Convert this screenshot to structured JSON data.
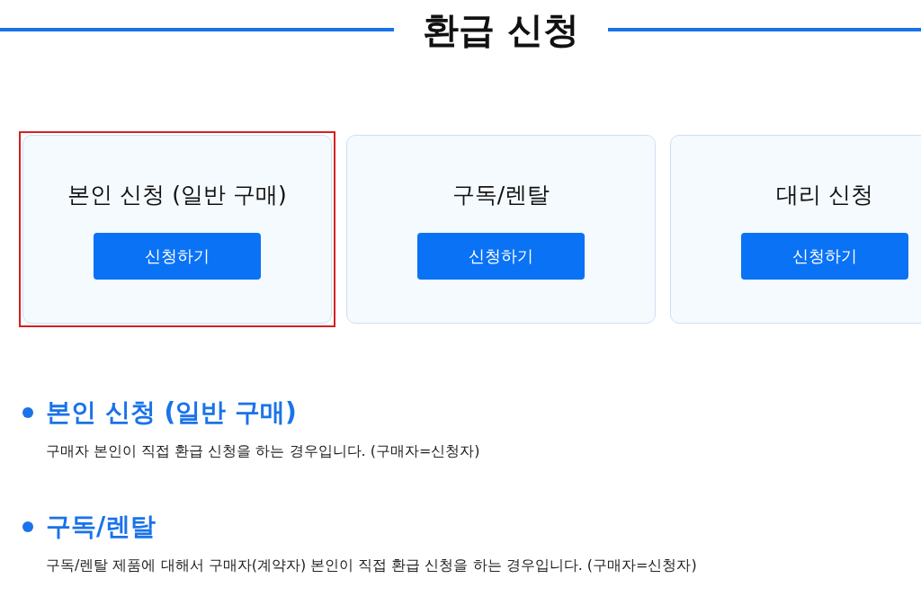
{
  "title": "환급 신청",
  "cards": [
    {
      "title": "본인 신청 (일반 구매)",
      "button": "신청하기",
      "selected": true
    },
    {
      "title": "구독/렌탈",
      "button": "신청하기",
      "selected": false
    },
    {
      "title": "대리 신청",
      "button": "신청하기",
      "selected": false
    }
  ],
  "sections": [
    {
      "heading": "본인 신청 (일반 구매)",
      "description": "구매자 본인이 직접 환급 신청을 하는 경우입니다. (구매자=신청자)"
    },
    {
      "heading": "구독/렌탈",
      "description": "구독/렌탈 제품에 대해서 구매자(계약자) 본인이 직접 환급 신청을 하는 경우입니다. (구매자=신청자)"
    }
  ]
}
